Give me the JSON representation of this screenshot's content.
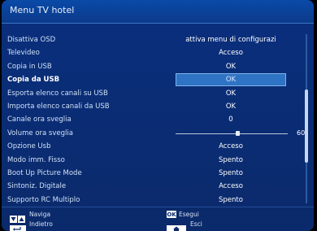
{
  "window": {
    "title": "Menu TV hotel"
  },
  "menu": {
    "items": [
      {
        "label": "Disattiva OSD",
        "value": "attiva menu di configurazi"
      },
      {
        "label": "Televideo",
        "value": "Acceso"
      },
      {
        "label": "Copia in USB",
        "value": "OK"
      },
      {
        "label": "Copia da USB",
        "value": "OK",
        "selected": true
      },
      {
        "label": "Esporta elenco canali su USB",
        "value": "OK"
      },
      {
        "label": "Importa elenco canali da USB",
        "value": "OK"
      },
      {
        "label": "Canale ora sveglia",
        "value": "0"
      },
      {
        "label": "Volume ora sveglia",
        "value": "60",
        "type": "slider",
        "level": 0.55
      },
      {
        "label": "Opzione Usb",
        "value": "Acceso"
      },
      {
        "label": "Modo imm. Fisso",
        "value": "Spento"
      },
      {
        "label": "Boot Up Picture Mode",
        "value": "Spento"
      },
      {
        "label": "Sintoniz. Digitale",
        "value": "Acceso"
      },
      {
        "label": "Supporto RC Multiplo",
        "value": "Spento"
      }
    ]
  },
  "footer": {
    "navigate_label": "Naviga",
    "back_label": "Indietro",
    "ok_button": "OK",
    "execute_label": "Esegui",
    "exit_label": "Esci"
  },
  "icons": {
    "navigate": "up-down-arrows-icon",
    "back": "return-arrow-icon",
    "ok": "ok-button-icon",
    "home": "home-icon"
  },
  "colors": {
    "background": "#0b2a6b",
    "highlight": "#2f73c4"
  }
}
